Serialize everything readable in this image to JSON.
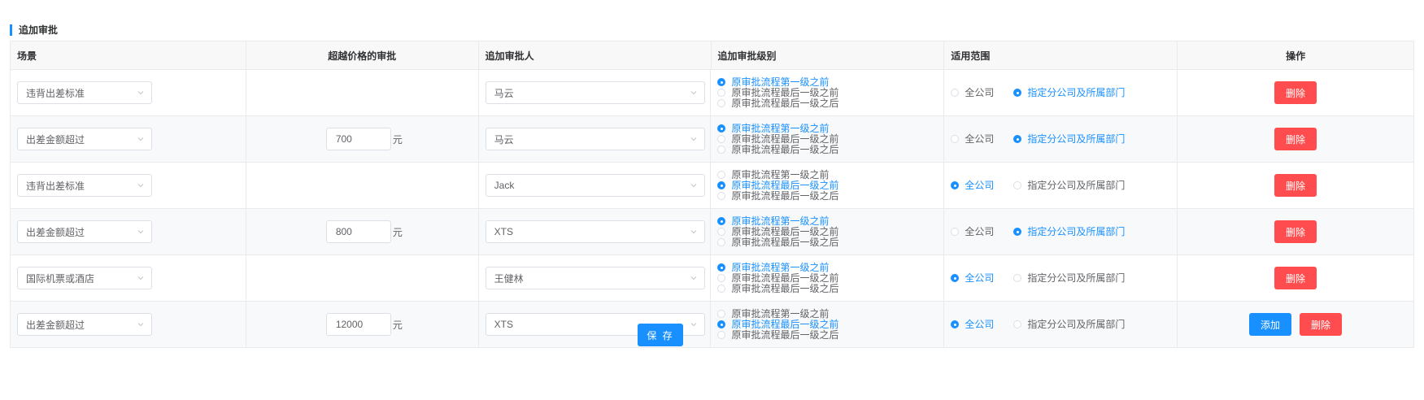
{
  "section": {
    "title": "追加审批"
  },
  "table": {
    "headers": [
      "场景",
      "超越价格的审批",
      "追加审批人",
      "追加审批级别",
      "适用范围",
      "操作"
    ],
    "level_options": [
      "原审批流程第一级之前",
      "原审批流程最后一级之前",
      "原审批流程最后一级之后"
    ],
    "scope_options": [
      "全公司",
      "指定分公司及所属部门"
    ],
    "unit": "元",
    "delete_label": "删除",
    "add_label": "添加",
    "rows": [
      {
        "scene": "违背出差标准",
        "price": "",
        "approver": "马云",
        "level_index": 0,
        "scope_index": 1,
        "has_add": false
      },
      {
        "scene": "出差金额超过",
        "price": "700",
        "approver": "马云",
        "level_index": 0,
        "scope_index": 1,
        "has_add": false
      },
      {
        "scene": "违背出差标准",
        "price": "",
        "approver": "Jack",
        "level_index": 1,
        "scope_index": 0,
        "has_add": false
      },
      {
        "scene": "出差金额超过",
        "price": "800",
        "approver": "XTS",
        "level_index": 0,
        "scope_index": 1,
        "has_add": false
      },
      {
        "scene": "国际机票或酒店",
        "price": "",
        "approver": "王健林",
        "level_index": 0,
        "scope_index": 0,
        "has_add": false
      },
      {
        "scene": "出差金额超过",
        "price": "12000",
        "approver": "XTS",
        "level_index": 1,
        "scope_index": 0,
        "has_add": true
      }
    ]
  },
  "save_label": "保 存",
  "colors": {
    "primary": "#1890ff",
    "danger": "#ff4d4f",
    "border": "#e8eaec",
    "header_bg": "#f8f8f9"
  },
  "icons": {
    "select_arrow": "chevron-down-icon",
    "section_marker": "accent-bar"
  }
}
